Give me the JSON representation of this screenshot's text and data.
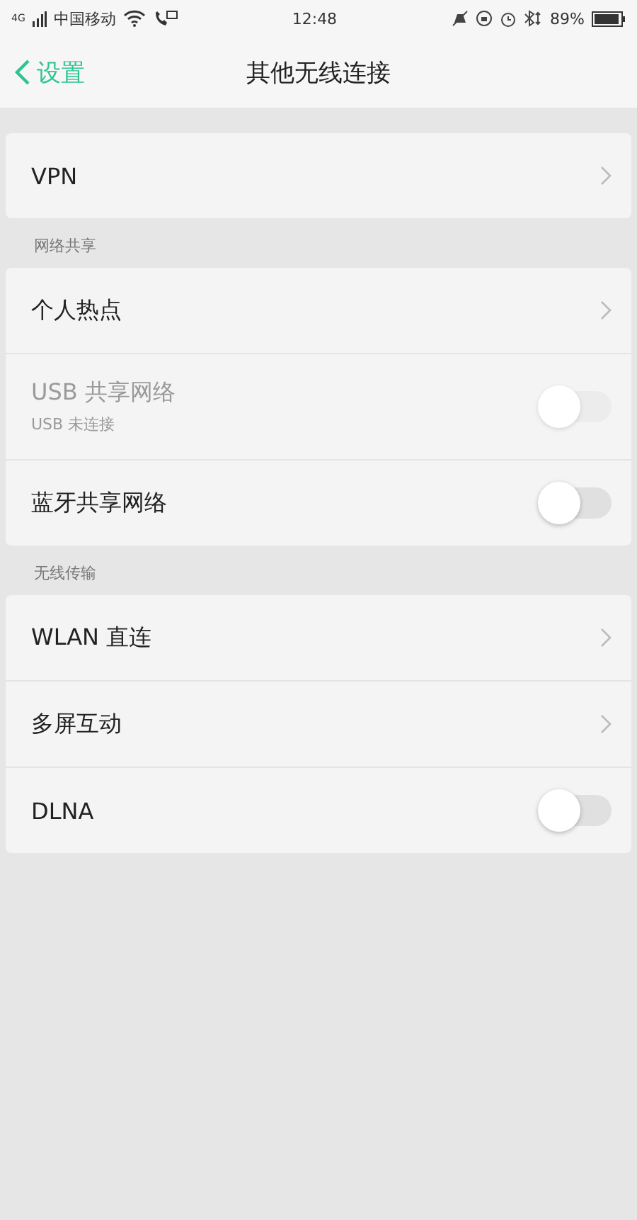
{
  "status_bar": {
    "network": "4G",
    "carrier": "中国移动",
    "time": "12:48",
    "battery_text": "89%"
  },
  "nav": {
    "back_label": "设置",
    "title": "其他无线连接"
  },
  "groups": [
    {
      "items": [
        {
          "kind": "link",
          "label": "VPN",
          "disabled": false
        }
      ]
    },
    {
      "header": "网络共享",
      "items": [
        {
          "kind": "link",
          "label": "个人热点",
          "disabled": false
        },
        {
          "kind": "toggle",
          "label": "USB 共享网络",
          "subtitle": "USB 未连接",
          "on": false,
          "disabled": true
        },
        {
          "kind": "toggle",
          "label": "蓝牙共享网络",
          "on": false,
          "disabled": false
        }
      ]
    },
    {
      "header": "无线传输",
      "items": [
        {
          "kind": "link",
          "label": "WLAN 直连",
          "disabled": false
        },
        {
          "kind": "link",
          "label": "多屏互动",
          "disabled": false
        },
        {
          "kind": "toggle",
          "label": "DLNA",
          "on": false,
          "disabled": false
        }
      ]
    }
  ]
}
